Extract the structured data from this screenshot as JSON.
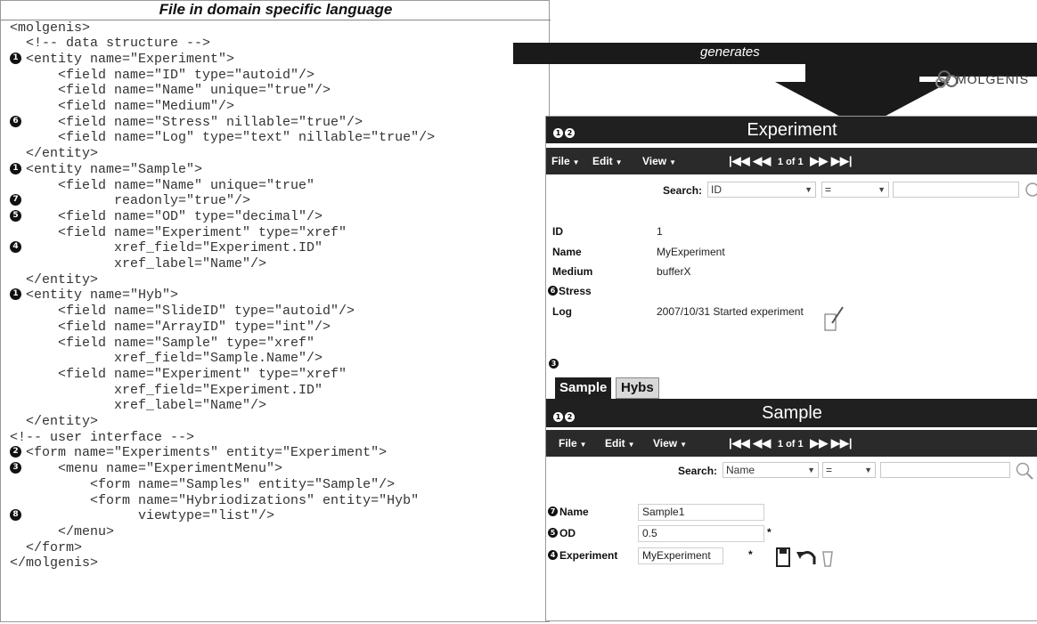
{
  "code_panel": {
    "title": "File in domain specific language",
    "lines": [
      {
        "marker": "",
        "text": "<molgenis>"
      },
      {
        "marker": "",
        "text": "  <!-- data structure -->"
      },
      {
        "marker": "1",
        "text": "  <entity name=\"Experiment\">"
      },
      {
        "marker": "",
        "text": "      <field name=\"ID\" type=\"autoid\"/>"
      },
      {
        "marker": "",
        "text": "      <field name=\"Name\" unique=\"true\"/>"
      },
      {
        "marker": "",
        "text": "      <field name=\"Medium\"/>"
      },
      {
        "marker": "6",
        "text": "      <field name=\"Stress\" nillable=\"true\"/>"
      },
      {
        "marker": "",
        "text": "      <field name=\"Log\" type=\"text\" nillable=\"true\"/>"
      },
      {
        "marker": "",
        "text": "  </entity>"
      },
      {
        "marker": "1",
        "text": "  <entity name=\"Sample\">"
      },
      {
        "marker": "",
        "text": "      <field name=\"Name\" unique=\"true\""
      },
      {
        "marker": "7",
        "text": "             readonly=\"true\"/>"
      },
      {
        "marker": "5",
        "text": "      <field name=\"OD\" type=\"decimal\"/>"
      },
      {
        "marker": "",
        "text": "      <field name=\"Experiment\" type=\"xref\""
      },
      {
        "marker": "4",
        "text": "             xref_field=\"Experiment.ID\""
      },
      {
        "marker": "",
        "text": "             xref_label=\"Name\"/>"
      },
      {
        "marker": "",
        "text": "  </entity>"
      },
      {
        "marker": "1",
        "text": "  <entity name=\"Hyb\">"
      },
      {
        "marker": "",
        "text": "      <field name=\"SlideID\" type=\"autoid\"/>"
      },
      {
        "marker": "",
        "text": "      <field name=\"ArrayID\" type=\"int\"/>"
      },
      {
        "marker": "",
        "text": "      <field name=\"Sample\" type=\"xref\""
      },
      {
        "marker": "",
        "text": "             xref_field=\"Sample.Name\"/>"
      },
      {
        "marker": "",
        "text": "      <field name=\"Experiment\" type=\"xref\""
      },
      {
        "marker": "",
        "text": "             xref_field=\"Experiment.ID\""
      },
      {
        "marker": "",
        "text": "             xref_label=\"Name\"/>"
      },
      {
        "marker": "",
        "text": "  </entity>"
      },
      {
        "marker": "",
        "text": "<!-- user interface -->"
      },
      {
        "marker": "2",
        "text": "  <form name=\"Experiments\" entity=\"Experiment\">"
      },
      {
        "marker": "3",
        "text": "      <menu name=\"ExperimentMenu\">"
      },
      {
        "marker": "",
        "text": "          <form name=\"Samples\" entity=\"Sample\"/>"
      },
      {
        "marker": "",
        "text": "          <form name=\"Hybriodizations\" entity=\"Hyb\""
      },
      {
        "marker": "8",
        "text": "                viewtype=\"list\"/>"
      },
      {
        "marker": "",
        "text": "      </menu>"
      },
      {
        "marker": "",
        "text": "  </form>"
      },
      {
        "marker": "",
        "text": "</molgenis>"
      }
    ]
  },
  "arrow_label": "generates",
  "logo_text": "MOLGENIS",
  "experiment_form": {
    "markers": [
      "1",
      "2"
    ],
    "title": "Experiment",
    "menu": [
      "File",
      "Edit",
      "View"
    ],
    "pager_text": "1 of 1",
    "search_label": "Search:",
    "search_field": "ID",
    "search_op": "=",
    "fields": [
      {
        "marker": "",
        "label": "ID",
        "value": "1"
      },
      {
        "marker": "",
        "label": "Name",
        "value": "MyExperiment"
      },
      {
        "marker": "",
        "label": "Medium",
        "value": "bufferX"
      },
      {
        "marker": "6",
        "label": "Stress",
        "value": ""
      },
      {
        "marker": "",
        "label": "Log",
        "value": "2007/10/31 Started experiment"
      }
    ]
  },
  "menu_marker": "3",
  "tabs": [
    "Sample",
    "Hybs"
  ],
  "sample_form": {
    "markers": [
      "1",
      "2"
    ],
    "title": "Sample",
    "menu": [
      "File",
      "Edit",
      "View"
    ],
    "pager_text": "1 of 1",
    "search_label": "Search:",
    "search_field": "Name",
    "search_op": "=",
    "fields": [
      {
        "marker": "7",
        "label": "Name",
        "value": "Sample1"
      },
      {
        "marker": "5",
        "label": "OD",
        "value": "0.5"
      },
      {
        "marker": "4",
        "label": "Experiment",
        "value": "MyExperiment"
      }
    ],
    "required_mark": "*"
  }
}
